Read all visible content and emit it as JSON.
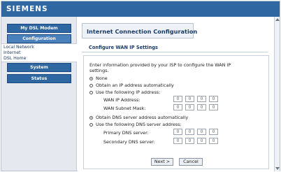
{
  "brand": {
    "logo": "SIEMENS"
  },
  "sidebar": {
    "items": [
      {
        "label": "My DSL Modem"
      },
      {
        "label": "Configuration"
      },
      {
        "label": "System"
      },
      {
        "label": "Status"
      }
    ],
    "subitems": [
      {
        "label": "Local Network"
      },
      {
        "label": "Internet"
      },
      {
        "label": "DSL Home"
      }
    ]
  },
  "page": {
    "title": "Internet Connection Configuration",
    "section_title": "Configure WAN IP Settings",
    "intro": "Enter information provided by your ISP to configure the WAN IP settings."
  },
  "wan_ip": {
    "options": [
      {
        "label": "None",
        "selected": true
      },
      {
        "label": "Obtain an IP address automatically",
        "selected": false
      },
      {
        "label": "Use the following IP address:",
        "selected": false
      }
    ],
    "ip_address_label": "WAN IP Address:",
    "subnet_mask_label": "WAN Subnet Mask:",
    "ip_address": [
      "0",
      "0",
      "0",
      "0"
    ],
    "subnet_mask": [
      "0",
      "0",
      "0",
      "0"
    ]
  },
  "dns": {
    "options": [
      {
        "label": "Obtain DNS server address automatically",
        "selected": true
      },
      {
        "label": "Use the following DNS server address:",
        "selected": false
      }
    ],
    "primary_label": "Primary DNS server:",
    "secondary_label": "Secondary DNS server:",
    "primary": [
      "0",
      "0",
      "0",
      "0"
    ],
    "secondary": [
      "0",
      "0",
      "0",
      "0"
    ]
  },
  "buttons": {
    "next": "Next >",
    "cancel": "Cancel"
  },
  "colors": {
    "brand_blue": "#2f67a3",
    "nav_active": "#4a80bc",
    "title_text": "#1b3c68"
  }
}
